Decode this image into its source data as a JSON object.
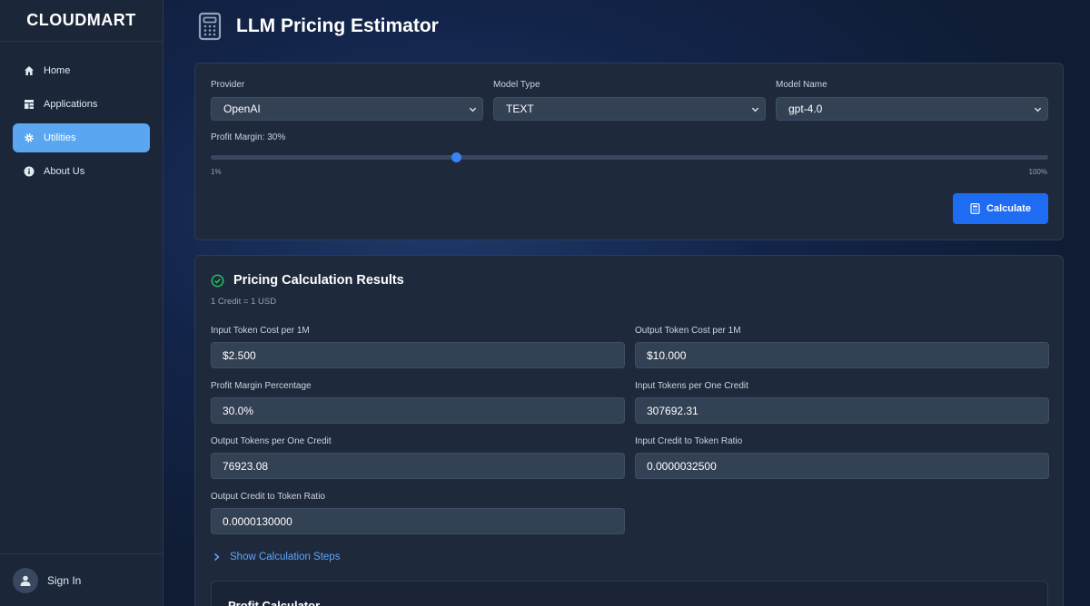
{
  "brand": "CLOUDMART",
  "sidebar": {
    "items": [
      {
        "label": "Home",
        "icon": "home-icon"
      },
      {
        "label": "Applications",
        "icon": "applications-icon"
      },
      {
        "label": "Utilities",
        "icon": "gear-icon",
        "active": true
      },
      {
        "label": "About Us",
        "icon": "info-icon"
      }
    ],
    "signin_label": "Sign In"
  },
  "header": {
    "title": "LLM Pricing Estimator",
    "icon": "calculator-icon"
  },
  "form": {
    "provider_label": "Provider",
    "provider_value": "OpenAI",
    "model_type_label": "Model Type",
    "model_type_value": "TEXT",
    "model_name_label": "Model Name",
    "model_name_value": "gpt-4.0",
    "margin_label": "Profit Margin: 30%",
    "margin_value_percent": 30,
    "margin_min_label": "1%",
    "margin_max_label": "100%",
    "calculate_label": "Calculate"
  },
  "results": {
    "title": "Pricing Calculation Results",
    "subtitle": "1 Credit = 1 USD",
    "fields": [
      {
        "label": "Input Token Cost per 1M",
        "value": "$2.500"
      },
      {
        "label": "Output Token Cost per 1M",
        "value": "$10.000"
      },
      {
        "label": "Profit Margin Percentage",
        "value": "30.0%"
      },
      {
        "label": "Input Tokens per One Credit",
        "value": "307692.31"
      },
      {
        "label": "Output Tokens per One Credit",
        "value": "76923.08"
      },
      {
        "label": "Input Credit to Token Ratio",
        "value": "0.0000032500"
      },
      {
        "label": "Output Credit to Token Ratio",
        "value": "0.0000130000"
      }
    ],
    "steps_label": "Show Calculation Steps",
    "profit_calc_title": "Profit Calculator"
  },
  "colors": {
    "accent": "#1d6cf2",
    "active_nav": "#5aa6f0",
    "success": "#22c55e",
    "link": "#60a5fa"
  }
}
